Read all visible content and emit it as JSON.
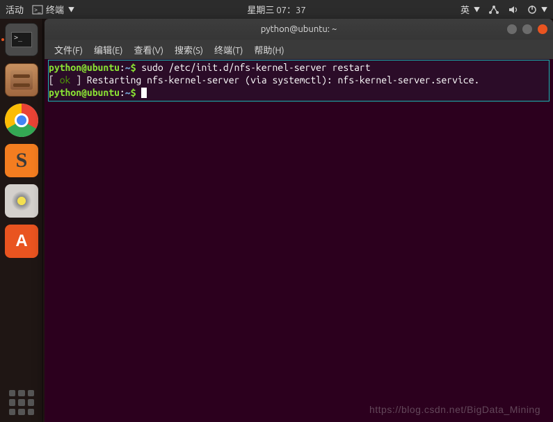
{
  "topbar": {
    "activities": "活动",
    "app_indicator": "终端",
    "datetime": "星期三 07：37",
    "input_lang": "英"
  },
  "dock": {
    "items": [
      "terminal-icon",
      "files-icon",
      "chrome-icon",
      "sublime-icon",
      "music-icon",
      "software-icon"
    ]
  },
  "window": {
    "title": "python@ubuntu: ~"
  },
  "menubar": {
    "file": "文件(F)",
    "edit": "编辑(E)",
    "view": "查看(V)",
    "search": "搜索(S)",
    "terminal_menu": "终端(T)",
    "help": "帮助(H)"
  },
  "terminal": {
    "prompt_user": "python@ubuntu",
    "prompt_sep": ":",
    "prompt_path": "~",
    "prompt_end": "$",
    "command1": " sudo /etc/init.d/nfs-kernel-server restart",
    "line2_prefix": "[ ",
    "line2_ok": "ok",
    "line2_rest": " ] Restarting nfs-kernel-server (via systemctl): nfs-kernel-server.service."
  },
  "watermark": "https://blog.csdn.net/BigData_Mining"
}
